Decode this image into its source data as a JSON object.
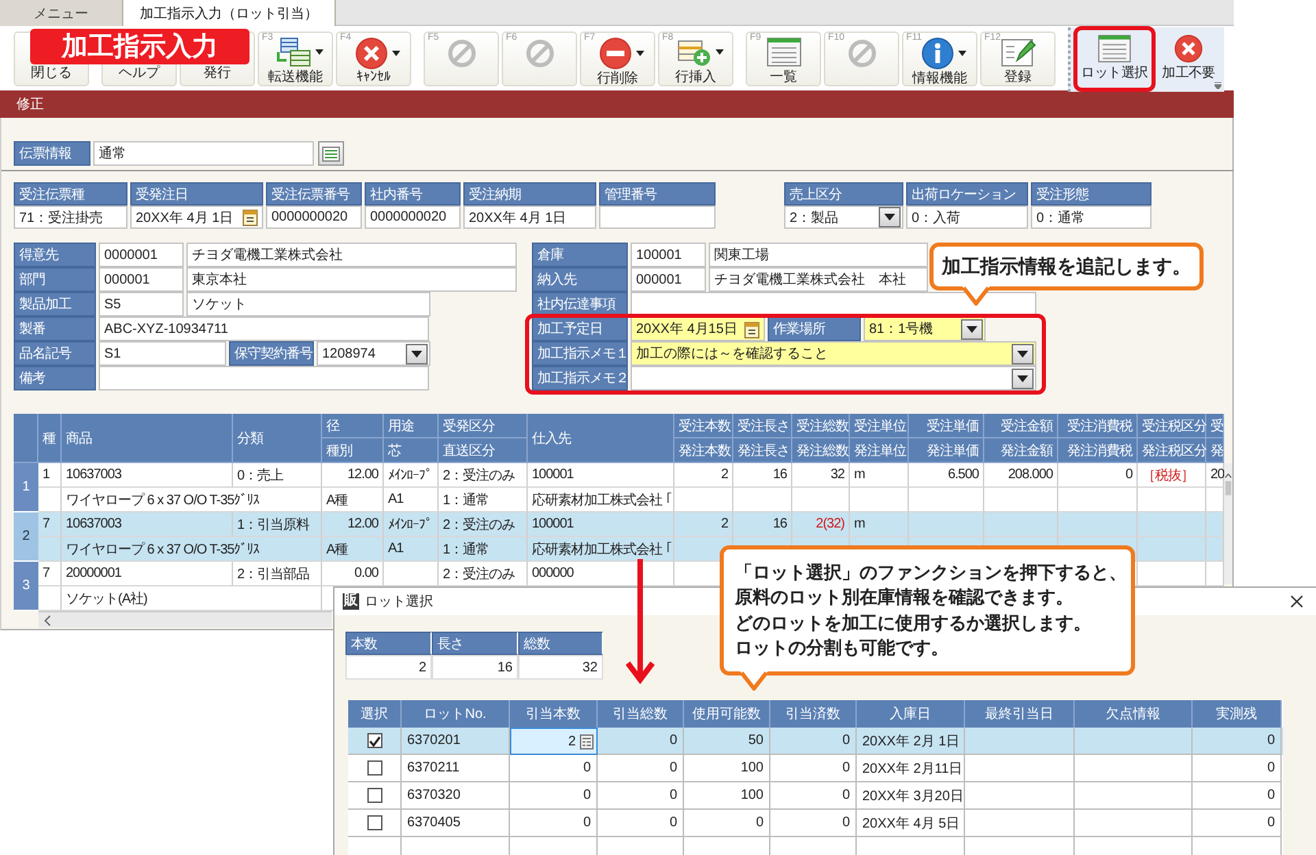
{
  "tabs": [
    {
      "label": "メニュー",
      "selected": false
    },
    {
      "label": "加工指示入力（ロット引当）",
      "selected": true
    }
  ],
  "toolbar": {
    "buttons": [
      {
        "label": "閉じる"
      },
      {
        "label": "ヘルプ"
      },
      {
        "label": "発行"
      },
      {
        "key": "F3",
        "label": "転送機能",
        "kind": "transfer",
        "dropdown": true
      },
      {
        "key": "F4",
        "label": "ｷｬﾝｾﾙ",
        "kind": "cancel",
        "dropdown": true
      },
      {
        "key": "F5",
        "kind": "ban",
        "dropdown": false
      },
      {
        "key": "F6",
        "kind": "ban",
        "dropdown": false
      },
      {
        "key": "F7",
        "label": "行削除",
        "kind": "delete",
        "dropdown": true
      },
      {
        "key": "F8",
        "label": "行挿入",
        "kind": "insert",
        "dropdown": true
      },
      {
        "key": "F9",
        "label": "一覧",
        "kind": "list",
        "dropdown": false
      },
      {
        "key": "F10",
        "kind": "ban",
        "dropdown": false
      },
      {
        "key": "F11",
        "label": "情報機能",
        "kind": "info",
        "dropdown": true
      },
      {
        "key": "F12",
        "label": "登録",
        "kind": "register",
        "dropdown": false
      }
    ],
    "extra_buttons": [
      {
        "label": "ロット選択",
        "kind": "list"
      },
      {
        "label": "加工不要",
        "kind": "cancel"
      }
    ]
  },
  "mode": "修正",
  "slip": {
    "label": "伝票情報",
    "value": "通常"
  },
  "order_header": {
    "groups": [
      [
        {
          "label": "受注伝票種",
          "value": "71：受注掛売",
          "kind": "text"
        },
        {
          "label": "受発注日",
          "value": "20XX年 4月 1日",
          "kind": "date"
        },
        {
          "label": "受注伝票番号",
          "value": "0000000020",
          "kind": "number"
        },
        {
          "label": "社内番号",
          "value": "0000000020",
          "kind": "number"
        },
        {
          "label": "受注納期",
          "value": "20XX年 4月 1日",
          "kind": "text"
        },
        {
          "label": "管理番号",
          "kind": "text"
        }
      ],
      [
        {
          "label": "売上区分",
          "value": "2：製品",
          "kind": "select"
        },
        {
          "label": "出荷ロケーション",
          "value": "0：入荷",
          "kind": "text"
        },
        {
          "label": "受注形態",
          "value": "0：通常",
          "kind": "text"
        }
      ]
    ]
  },
  "form_left": {
    "rows": [
      [
        {
          "kind": "label",
          "text": "得意先"
        },
        {
          "kind": "field",
          "value": "0000001"
        },
        {
          "kind": "field",
          "value": "チヨダ電機工業株式会社"
        }
      ],
      [
        {
          "kind": "label",
          "text": "部門"
        },
        {
          "kind": "field",
          "value": "000001"
        },
        {
          "kind": "field",
          "value": "東京本社"
        }
      ],
      [
        {
          "kind": "label",
          "text": "製品加工"
        },
        {
          "kind": "field",
          "value": "S5"
        },
        {
          "kind": "field",
          "value": "ソケット"
        }
      ],
      [
        {
          "kind": "label",
          "text": "製番"
        },
        {
          "kind": "field",
          "value": "ABC-XYZ-10934711"
        }
      ],
      [
        {
          "kind": "label",
          "text": "品名記号"
        },
        {
          "kind": "field",
          "value": "S1"
        },
        {
          "kind": "label",
          "text": "保守契約番号"
        },
        {
          "kind": "select",
          "value": "1208974"
        }
      ],
      [
        {
          "kind": "label",
          "text": "備考"
        },
        {
          "kind": "field"
        }
      ]
    ]
  },
  "form_right": {
    "rows": [
      [
        {
          "kind": "label",
          "text": "倉庫"
        },
        {
          "kind": "field",
          "value": "100001",
          "highlighted": false
        },
        {
          "kind": "field",
          "value": "関東工場",
          "highlighted": false
        }
      ],
      [
        {
          "kind": "label",
          "text": "納入先"
        },
        {
          "kind": "field",
          "value": "000001",
          "highlighted": false
        },
        {
          "kind": "field",
          "value": "チヨダ電機工業株式会社　本社",
          "highlighted": false
        }
      ],
      [
        {
          "kind": "label",
          "text": "社内伝達事項"
        },
        {
          "kind": "field",
          "highlighted": false
        }
      ],
      [
        {
          "kind": "label",
          "text": "加工予定日"
        },
        {
          "kind": "date",
          "value": "20XX年 4月15日",
          "highlighted": true
        },
        {
          "kind": "label",
          "text": "作業場所"
        },
        {
          "kind": "select",
          "value": "81：1号機",
          "highlighted": true
        }
      ],
      [
        {
          "kind": "label",
          "text": "加工指示メモ１"
        },
        {
          "kind": "select",
          "value": "加工の際には～を確認すること",
          "highlighted": true
        }
      ],
      [
        {
          "kind": "label",
          "text": "加工指示メモ２"
        },
        {
          "kind": "select",
          "highlighted": false
        }
      ]
    ]
  },
  "table": {
    "columns": [
      {
        "top": "種"
      },
      {
        "top": "商品"
      },
      {
        "top": "分類"
      },
      {
        "top": "径",
        "bottom": "種別"
      },
      {
        "top": "用途",
        "bottom": "芯"
      },
      {
        "top": "受発区分",
        "bottom": "直送区分"
      },
      {
        "top": "仕入先"
      },
      {
        "top": "受注本数",
        "bottom": "発注本数"
      },
      {
        "top": "受注長さ",
        "bottom": "発注長さ"
      },
      {
        "top": "受注総数",
        "bottom": "発注総数"
      },
      {
        "top": "受注単位",
        "bottom": "発注単位"
      },
      {
        "top": "受注単価",
        "bottom": "発注単価"
      },
      {
        "top": "受注金額",
        "bottom": "発注金額"
      },
      {
        "top": "受注消費税",
        "bottom": "発注消費税"
      },
      {
        "top": "受注税区分",
        "bottom": "発注税区分"
      },
      {
        "top": "受",
        "bottom": "発"
      }
    ],
    "rows": [
      {
        "number": "1",
        "selected": false,
        "kind_no": "1",
        "product": "10637003",
        "category": "0：売上",
        "diameter": "12.00",
        "use": "ﾒｲﾝﾛｰﾌﾟ",
        "order_type": "2：受注のみ",
        "supplier": "100001",
        "order_qty": "2",
        "order_length": "16",
        "order_total": {
          "text": "32",
          "alert": false
        },
        "order_unit": "m",
        "order_price": "6.500",
        "order_amount": "208.000",
        "order_tax": "0",
        "order_tax_type": {
          "text": "［税抜］",
          "alert": true
        },
        "col_15": "20",
        "product_name": "ワイヤロープ 6 x 37 O/O T-35ｸﾞﾘｽ",
        "grade": "A種",
        "core": "A1",
        "direct_type": "1：通常",
        "supplier_name": "応研素材加工株式会社 ｢"
      },
      {
        "number": "2",
        "selected": true,
        "kind_no": "7",
        "product": "10637003",
        "category": "1：引当原料",
        "diameter": "12.00",
        "use": "ﾒｲﾝﾛｰﾌﾟ",
        "order_type": "2：受注のみ",
        "supplier": "100001",
        "order_qty": "2",
        "order_length": "16",
        "order_total": {
          "text": "2(32)",
          "alert": true
        },
        "order_unit": "m",
        "product_name": "ワイヤロープ 6 x 37 O/O T-35ｸﾞﾘｽ",
        "grade": "A種",
        "core": "A1",
        "direct_type": "1：通常",
        "supplier_name": "応研素材加工株式会社 ｢"
      },
      {
        "number": "3",
        "selected": false,
        "kind_no": "7",
        "product": "20000001",
        "category": "2：引当部品",
        "diameter": "0.00",
        "order_type": "2：受注のみ",
        "supplier": "000000",
        "product_name": "ソケット(A社)"
      }
    ]
  },
  "lot_dialog": {
    "logo": "販",
    "title": "ロット選択",
    "summary": {
      "columns": [
        "本数",
        "長さ",
        "総数"
      ],
      "values": [
        "2",
        "16",
        "32"
      ]
    },
    "columns": [
      "選択",
      "ロットNo.",
      "引当本数",
      "引当総数",
      "使用可能数",
      "引当済数",
      "入庫日",
      "最終引当日",
      "欠点情報",
      "実測残"
    ],
    "rows": [
      {
        "selected": true,
        "checked": true,
        "lot_no": "6370201",
        "alloc_qty": "2",
        "alloc_total": "0",
        "available": "50",
        "allocated": "0",
        "received": "20XX年 2月 1日",
        "remaining": "0"
      },
      {
        "selected": false,
        "checked": false,
        "lot_no": "6370211",
        "alloc_qty": "0",
        "alloc_total": "0",
        "available": "100",
        "allocated": "0",
        "received": "20XX年 2月11日",
        "remaining": "0"
      },
      {
        "selected": false,
        "checked": false,
        "lot_no": "6370320",
        "alloc_qty": "0",
        "alloc_total": "0",
        "available": "100",
        "allocated": "0",
        "received": "20XX年 3月20日",
        "remaining": "0"
      },
      {
        "selected": false,
        "checked": false,
        "lot_no": "6370405",
        "alloc_qty": "0",
        "alloc_total": "0",
        "available": "0",
        "allocated": "0",
        "received": "20XX年 4月 5日",
        "remaining": "0"
      }
    ]
  },
  "annotations": {
    "title_badge": "加工指示入力",
    "callouts": [
      {
        "lines": [
          "加工指示情報を追記します。"
        ]
      },
      {
        "lines": [
          "「ロット選択」のファンクションを押下すると、",
          "原料のロット別在庫情報を確認できます。",
          "どのロットを加工に使用するか選択します。",
          "ロットの分割も可能です。"
        ]
      }
    ]
  }
}
